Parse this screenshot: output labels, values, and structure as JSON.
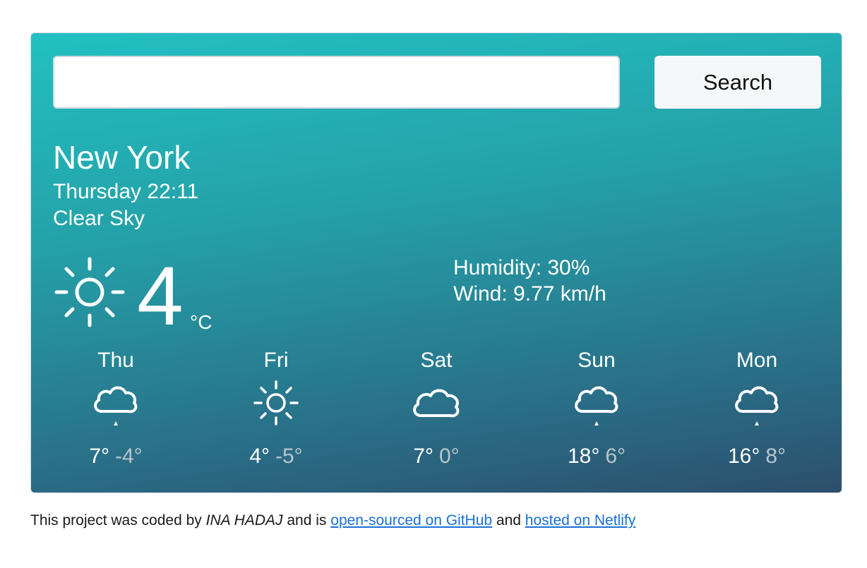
{
  "search": {
    "value": "",
    "button_label": "Search"
  },
  "current": {
    "city": "New York",
    "date": "Thursday 22:11",
    "description": "Clear Sky",
    "icon": "clear-sky-icon",
    "temperature": "4",
    "unit": "°C",
    "humidity": "Humidity: 30%",
    "wind": "Wind: 9.77 km/h"
  },
  "forecast": [
    {
      "day": "Thu",
      "icon": "cloud-rain-icon",
      "max": "7°",
      "min": "-4°"
    },
    {
      "day": "Fri",
      "icon": "sun-icon",
      "max": "4°",
      "min": "-5°"
    },
    {
      "day": "Sat",
      "icon": "cloud-icon",
      "max": "7°",
      "min": "0°"
    },
    {
      "day": "Sun",
      "icon": "cloud-rain-icon",
      "max": "18°",
      "min": "6°"
    },
    {
      "day": "Mon",
      "icon": "cloud-rain-icon",
      "max": "16°",
      "min": "8°"
    }
  ],
  "footer": {
    "prefix": "This project was coded by ",
    "author": "INA HADAJ",
    "middle": " and is ",
    "github_link": "open-sourced on GitHub",
    "and": " and ",
    "netlify_link": "hosted on Netlify"
  },
  "colors": {
    "gradient_top": "#22c0c2",
    "gradient_bottom": "#2c4f6c",
    "link": "#1a6fd6",
    "min_temp": "#b7c6cc"
  }
}
